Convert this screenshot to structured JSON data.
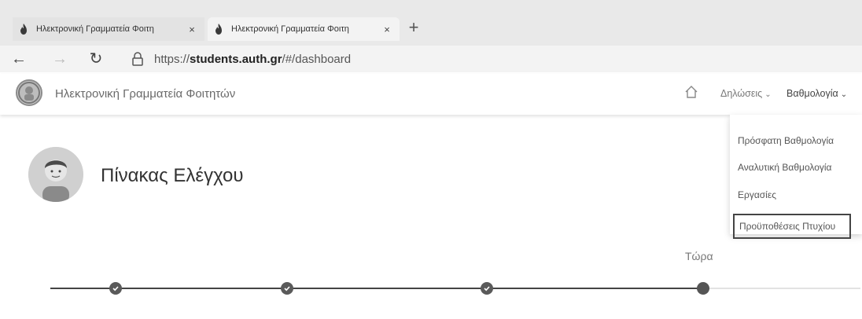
{
  "browser": {
    "tabs": [
      {
        "title": "Ηλεκτρονική Γραμματεία Φοιτη",
        "close": "×",
        "active": false
      },
      {
        "title": "Ηλεκτρονική Γραμματεία Φοιτη",
        "close": "×",
        "active": true
      }
    ],
    "new_tab": "+",
    "nav": {
      "back": "←",
      "forward": "→",
      "reload": "↻"
    },
    "url": {
      "scheme": "https://",
      "host": "students.auth.gr",
      "path": "/#/dashboard"
    }
  },
  "header": {
    "title": "Ηλεκτρονική Γραμματεία Φοιτητών",
    "nav": {
      "declarations": "Δηλώσεις",
      "grades": "Βαθμολογία",
      "chevron": "⌄"
    }
  },
  "dropdown": {
    "items": [
      "Πρόσφατη Βαθμολογία",
      "Αναλυτική Βαθμολογία",
      "Εργασίες",
      "Προϋποθέσεις Πτυχίου"
    ],
    "highlighted_index": 3
  },
  "main": {
    "page_title": "Πίνακας Ελέγχου",
    "timeline": {
      "now_label": "Τώρα"
    }
  },
  "icons": {
    "tab_favicon": "flame-icon",
    "lock": "lock-icon",
    "home": "home-icon",
    "check": "check-icon",
    "logo": "university-seal",
    "avatar": "student-avatar"
  },
  "colors": {
    "tabbar_bg": "#e9e9e9",
    "header_bg": "#ffffff",
    "timeline": "#444444",
    "node": "#5a5a5a"
  }
}
